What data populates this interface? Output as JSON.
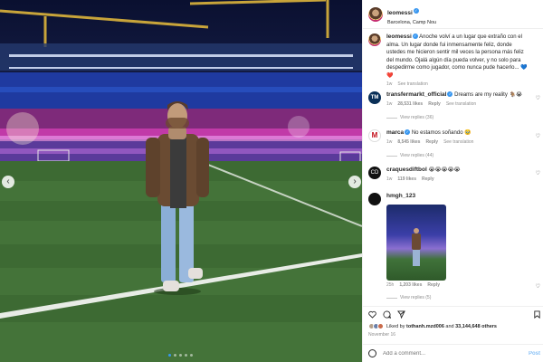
{
  "post": {
    "username": "leomessi",
    "location": "Barcelona, Camp Nou",
    "caption": "Anoche volví a un lugar que extraño con el alma. Un lugar donde fui inmensamente feliz, donde ustedes me hicieron sentir mil veces la persona más feliz del mundo. Ojalá algún día pueda volver, y no solo para despedirme como jugador, como nunca pude hacerlo... 💙❤️",
    "caption_time": "1w",
    "see_translation": "See translation"
  },
  "comments": [
    {
      "user": "transfermarkt_official",
      "text": "Dreams are my reality 🐐😭",
      "time": "1w",
      "likes": "28,531 likes",
      "reply": "Reply",
      "see_translation": "See translation",
      "view_replies": "View replies (36)",
      "avatar": "TM"
    },
    {
      "user": "marca",
      "text": "No estamos soñando 🥹",
      "time": "1w",
      "likes": "8,545 likes",
      "reply": "Reply",
      "see_translation": "See translation",
      "view_replies": "View replies (44)",
      "avatar": "M"
    },
    {
      "user": "craquesdiftbol",
      "text": "😭😭😭😭😭",
      "time": "1w",
      "likes": "119 likes",
      "reply": "Reply",
      "avatar": "CD"
    },
    {
      "user": "hmgh_123",
      "time": "25h",
      "likes": "1,203 likes",
      "reply": "Reply",
      "view_replies": "View replies (5)"
    }
  ],
  "likes": {
    "liked_by_prefix": "Liked by ",
    "first_user": "tothanh.mzd006",
    "and": " and ",
    "others": "33,144,648 others"
  },
  "date": "November 16",
  "add_comment": {
    "placeholder": "Add a comment...",
    "post": "Post"
  },
  "icons": {
    "left_arrow": "chevron-left-icon",
    "right_arrow": "chevron-right-icon",
    "like": "heart-icon",
    "comment": "comment-icon",
    "share": "share-icon",
    "save": "bookmark-icon",
    "emoji": "emoji-icon"
  },
  "colors": {
    "accent": "#3897f0",
    "liked": "#ed4956"
  }
}
